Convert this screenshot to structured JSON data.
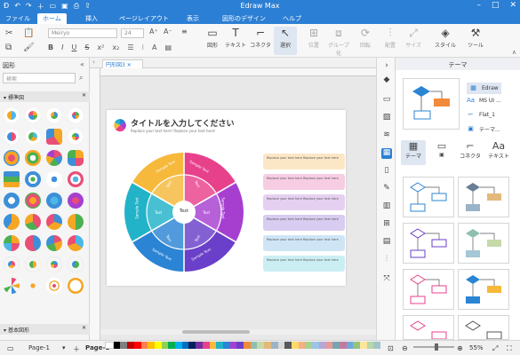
{
  "app": {
    "title": "Edraw Max"
  },
  "menu": {
    "items": [
      "ファイル",
      "ホーム",
      "挿入",
      "ページレイアウト",
      "表示",
      "図形のデザイン",
      "ヘルプ"
    ],
    "active": "ホーム"
  },
  "ribbon": {
    "font": "Meiryo",
    "size": "24",
    "tools": [
      {
        "label": "図形",
        "icon": "rectangle-icon"
      },
      {
        "label": "テキスト",
        "icon": "text-icon"
      },
      {
        "label": "コネクタ",
        "icon": "connector-icon"
      },
      {
        "label": "選択",
        "icon": "pointer-icon"
      },
      {
        "label": "位置",
        "icon": "position-icon"
      },
      {
        "label": "グループ化",
        "icon": "group-icon"
      },
      {
        "label": "回転",
        "icon": "rotate-icon"
      },
      {
        "label": "配置",
        "icon": "align-icon"
      },
      {
        "label": "サイズ",
        "icon": "size-icon"
      },
      {
        "label": "スタイル",
        "icon": "fill-icon"
      },
      {
        "label": "ツール",
        "icon": "tools-icon"
      }
    ]
  },
  "left_panel": {
    "title": "図形",
    "search_placeholder": "検索",
    "section1": "標準図",
    "section2": "基本図形"
  },
  "canvas": {
    "tab": "円形図3",
    "heading": "タイトルを入力してください",
    "subheading": "Replace your text here! Replace your text here!",
    "center": "Text",
    "sample": "Sample Text",
    "label": "Text",
    "list_text": "Replace your text here Replace your text here",
    "colors": {
      "yellow": "#f6b93b",
      "pink": "#e8418c",
      "purple": "#a63fd0",
      "indigo": "#6a3fc9",
      "blue": "#2b84d4",
      "teal": "#22b3c8"
    }
  },
  "right_panel": {
    "title": "テーマ",
    "themes": [
      "Edraw",
      "MS UI ...",
      "Flat_1",
      "テーマ..."
    ],
    "tools": [
      "テーマ",
      "",
      "コネクタ",
      "テキスト"
    ]
  },
  "status": {
    "page_nav": "Page-1",
    "page_tab": "Page-1",
    "zoom": "55%"
  }
}
